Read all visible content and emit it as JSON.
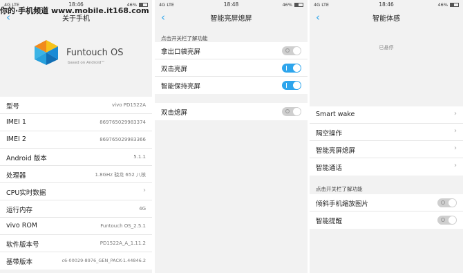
{
  "watermark": "你的·手机频道 www.mobile.it168.com",
  "screen1": {
    "status": {
      "signal": "4G LTE",
      "time": "18:46",
      "battery": "46%"
    },
    "title": "关于手机",
    "brand": {
      "name": "Funtouch OS",
      "sub": "based on Android™"
    },
    "rows": [
      {
        "label": "型号",
        "value": "vivo PD1522A"
      },
      {
        "label": "IMEI 1",
        "value": "869765029983374"
      },
      {
        "label": "IMEI 2",
        "value": "869765029983366"
      },
      {
        "label": "Android 版本",
        "value": "5.1.1"
      },
      {
        "label": "处理器",
        "value": "1.8GHz 骁龙 652 八核"
      },
      {
        "label": "CPU实时数据",
        "value": ""
      },
      {
        "label": "运行内存",
        "value": "4G"
      },
      {
        "label": "vivo ROM",
        "value": "Funtouch OS_2.5.1"
      },
      {
        "label": "软件版本号",
        "value": "PD1522A_A_1.11.2"
      },
      {
        "label": "基带版本",
        "value": "c6-00029-8976_GEN_PACK-1.44846.2"
      }
    ]
  },
  "screen2": {
    "status": {
      "signal": "4G LTE",
      "time": "18:48",
      "battery": "46%"
    },
    "title": "智能亮屏熄屏",
    "section_header": "点击开关栏了解功能",
    "toggles": [
      {
        "label": "拿出口袋亮屏",
        "on": false
      },
      {
        "label": "双击亮屏",
        "on": true
      },
      {
        "label": "智能保持亮屏",
        "on": true
      }
    ],
    "toggles2": [
      {
        "label": "双击熄屏",
        "on": false
      }
    ]
  },
  "screen3": {
    "status": {
      "signal": "4G LTE",
      "time": "18:46",
      "battery": "46%"
    },
    "title": "智能体感",
    "paused_text": "已悬停",
    "nav_items": [
      {
        "label": "Smart wake"
      },
      {
        "label": "隔空操作"
      },
      {
        "label": "智能亮屏熄屏"
      },
      {
        "label": "智能通话"
      }
    ],
    "section_header": "点击开关栏了解功能",
    "toggles": [
      {
        "label": "倾斜手机缩放图片",
        "on": false
      },
      {
        "label": "智能提醒",
        "on": false
      }
    ]
  },
  "colors": {
    "accent": "#2ea5ec",
    "background": "#f2f2f2"
  },
  "icons": {
    "back": "chevron-left-icon",
    "chevron": "chevron-right-icon"
  }
}
